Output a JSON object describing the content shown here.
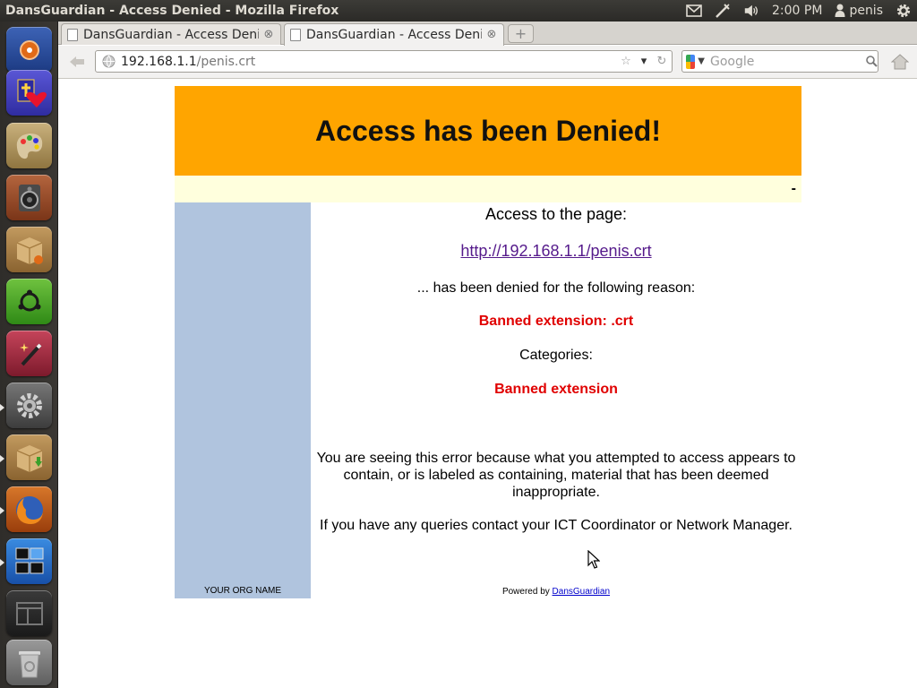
{
  "system_panel": {
    "window_title": "DansGuardian - Access Denied - Mozilla Firefox",
    "clock": "2:00 PM",
    "user": "penis",
    "icons": [
      "mail-icon",
      "network-icon",
      "volume-icon",
      "user-icon",
      "gear-icon"
    ]
  },
  "launcher": {
    "items": [
      "dash-home-icon",
      "bible-app-icon",
      "paint-app-icon",
      "speaker-app-icon",
      "package-app-icon",
      "ubuntu-one-icon",
      "magic-wand-app-icon",
      "system-settings-icon",
      "package-installer-icon",
      "firefox-icon",
      "workspace-switcher-icon",
      "window-app-icon",
      "trash-icon"
    ]
  },
  "tabs": [
    {
      "label": "DansGuardian - Access Denied"
    },
    {
      "label": "DansGuardian - Access Denied"
    }
  ],
  "navbar": {
    "url_host": "192.168.1.1",
    "url_path": "/penis.crt",
    "search_placeholder": "Google"
  },
  "page": {
    "heading": "Access has been Denied!",
    "strip_text": "-",
    "access_to_page": "Access to the page:",
    "blocked_url": "http://192.168.1.1/penis.crt",
    "reason_intro": "... has been denied for the following reason:",
    "reason": "Banned extension: .crt",
    "categories_label": "Categories:",
    "category": "Banned extension",
    "explanation": "You are seeing this error because what you attempted to access appears to contain, or is labeled as containing, material that has been deemed inappropriate.",
    "contact": "If you have any queries contact your ICT Coordinator or Network Manager.",
    "org_name": "YOUR ORG NAME",
    "powered_by_prefix": "Powered by",
    "powered_by_link": "DansGuardian"
  },
  "colors": {
    "header_bg": "#ffa500",
    "strip_bg": "#ffffdd",
    "sidebar_bg": "#b0c4de",
    "reason_color": "#e00000",
    "link_visited": "#551a8b"
  }
}
